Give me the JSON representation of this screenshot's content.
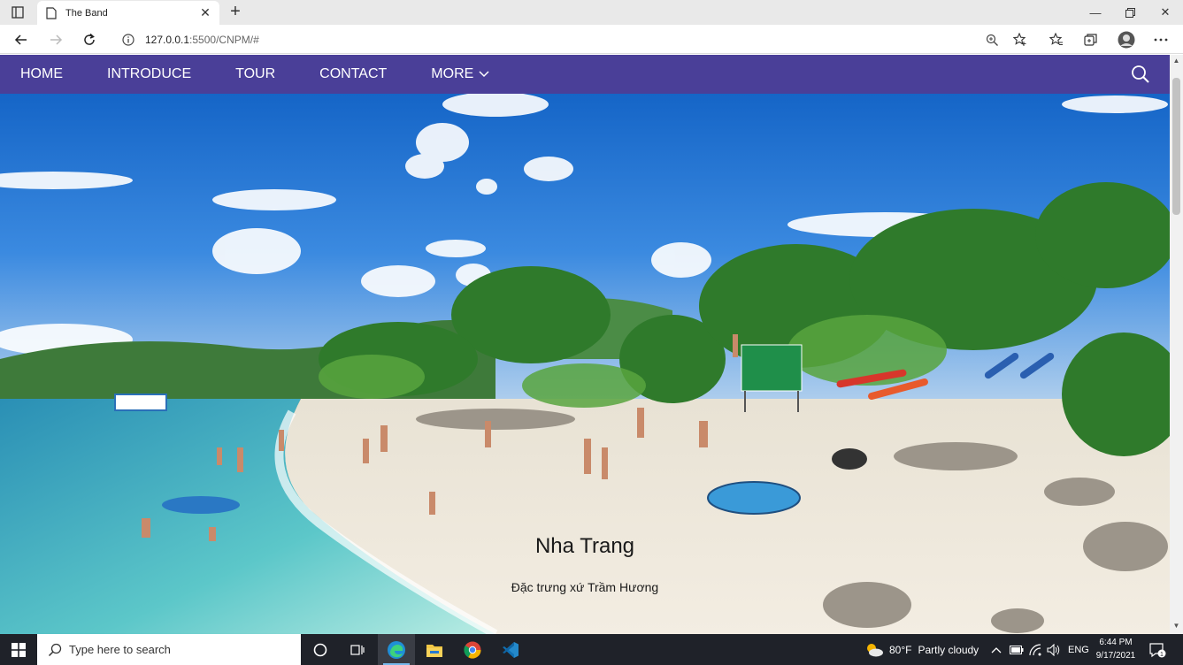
{
  "browser": {
    "tab_title": "The Band",
    "url_host": "127.0.0.1",
    "url_rest": ":5500/CNPM/#"
  },
  "nav": {
    "items": [
      "HOME",
      "INTRODUCE",
      "TOUR",
      "CONTACT",
      "MORE"
    ]
  },
  "hero": {
    "title": "Nha Trang",
    "subtitle": "Đặc trưng xứ Trầm Hương"
  },
  "taskbar": {
    "search_placeholder": "Type here to search",
    "weather_temp": "80°F",
    "weather_desc": "Partly cloudy",
    "language": "ENG",
    "time": "6:44 PM",
    "date": "9/17/2021",
    "notification_count": "1"
  },
  "colors": {
    "navbar": "#4a3f98",
    "taskbar": "#1f2229"
  }
}
